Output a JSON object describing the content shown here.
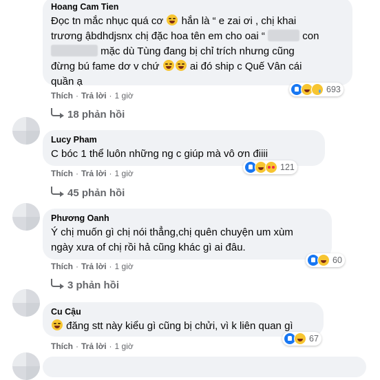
{
  "comments": [
    {
      "name": "Hoang Cam Tien",
      "lines": [
        [
          "Đọc tn mắc nhục quá cơ ",
          "😂",
          " hắn là “ e zai ơi , chị khai"
        ],
        [
          "trương ậbdhdjsnx chị đặc hoa tên em cho oai “ ",
          "[blurred]",
          " con"
        ],
        [
          "[blurred]",
          " mặc dù Tùng đang bị chỉ trích nhưng cũng"
        ],
        [
          "đừng bú fame dơ v chứ ",
          "😂😂",
          " ai đó ship c Quế Vân cái"
        ],
        [
          "quần ạ"
        ]
      ],
      "reactions": [
        "like",
        "haha",
        "sad"
      ],
      "reaction_count": "693",
      "action_like": "Thích",
      "action_reply": "Trả lời",
      "time": "1 giờ",
      "replies": "18 phản hồi"
    },
    {
      "name": "Lucy Pham",
      "text": "C bóc 1 thể luôn những ng c giúp mà vô ơn điiii",
      "reactions": [
        "like",
        "haha",
        "love"
      ],
      "reaction_count": "121",
      "action_like": "Thích",
      "action_reply": "Trả lời",
      "time": "1 giờ",
      "replies": "45 phản hồi"
    },
    {
      "name": "Phương Oanh",
      "line1": "Ý chị muốn gì chị nói thẳng,chị quên chuyện um xùm",
      "line2": "ngày xưa of chị rồi hả cũng khác gì ai đâu.",
      "reactions": [
        "like",
        "haha"
      ],
      "reaction_count": "60",
      "action_like": "Thích",
      "action_reply": "Trả lời",
      "time": "1 giờ",
      "replies": "3 phản hồi"
    },
    {
      "name": "Cu Cậu",
      "emoji": "🤣",
      "text": " đăng stt này kiểu gì cũng bị chửi, vì k liên quan gì",
      "reactions": [
        "like",
        "haha"
      ],
      "reaction_count": "67",
      "action_like": "Thích",
      "action_reply": "Trả lời",
      "time": "1 giờ"
    }
  ],
  "separator": "·"
}
